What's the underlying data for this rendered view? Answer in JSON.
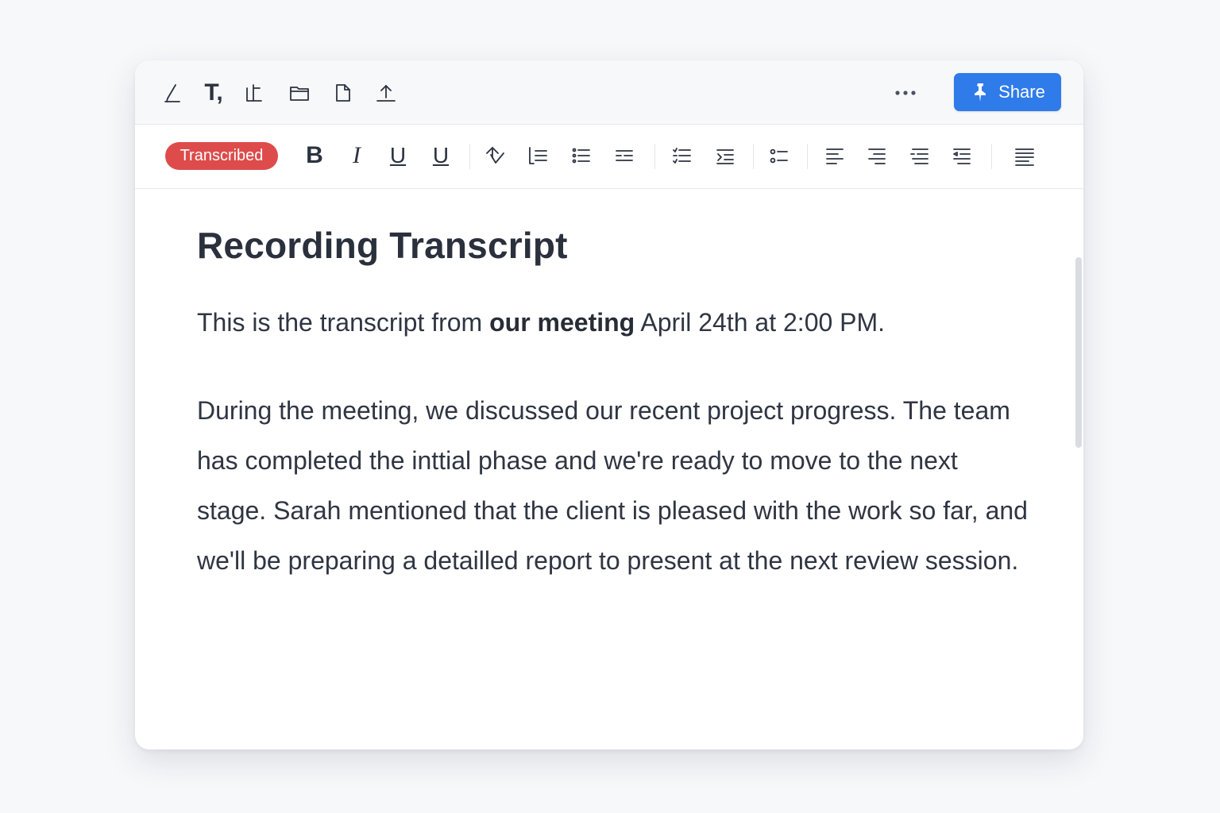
{
  "toolbar": {
    "tools": [
      {
        "icon": "pen-icon"
      },
      {
        "icon": "text-style-icon",
        "label": "T,"
      },
      {
        "icon": "insert-icon"
      },
      {
        "icon": "folder-icon"
      },
      {
        "icon": "file-icon"
      },
      {
        "icon": "upload-icon"
      }
    ],
    "more_icon": "more-dots-icon",
    "share_label": "Share",
    "share_icon": "pin-icon"
  },
  "format": {
    "badge_label": "Transcribed",
    "bold_label": "B",
    "italic_label": "I",
    "underline_label": "U",
    "underline2_label": "U"
  },
  "document": {
    "title": "Recording Transcript",
    "p1_prefix": "This is the transcript from ",
    "p1_bold": "our meeting",
    "p1_suffix": " April 24th at 2:00 PM.",
    "p2": "During the meeting, we discussed our recent project progress.  The team has completed the inttial phase and we're ready to move to the next stage. Sarah mentioned that the client is pleased with the work so far, and we'll be preparing a detailled report to present at the next review session."
  },
  "colors": {
    "accent": "#2f7bea",
    "badge": "#de4b4b",
    "text": "#2f3542"
  }
}
